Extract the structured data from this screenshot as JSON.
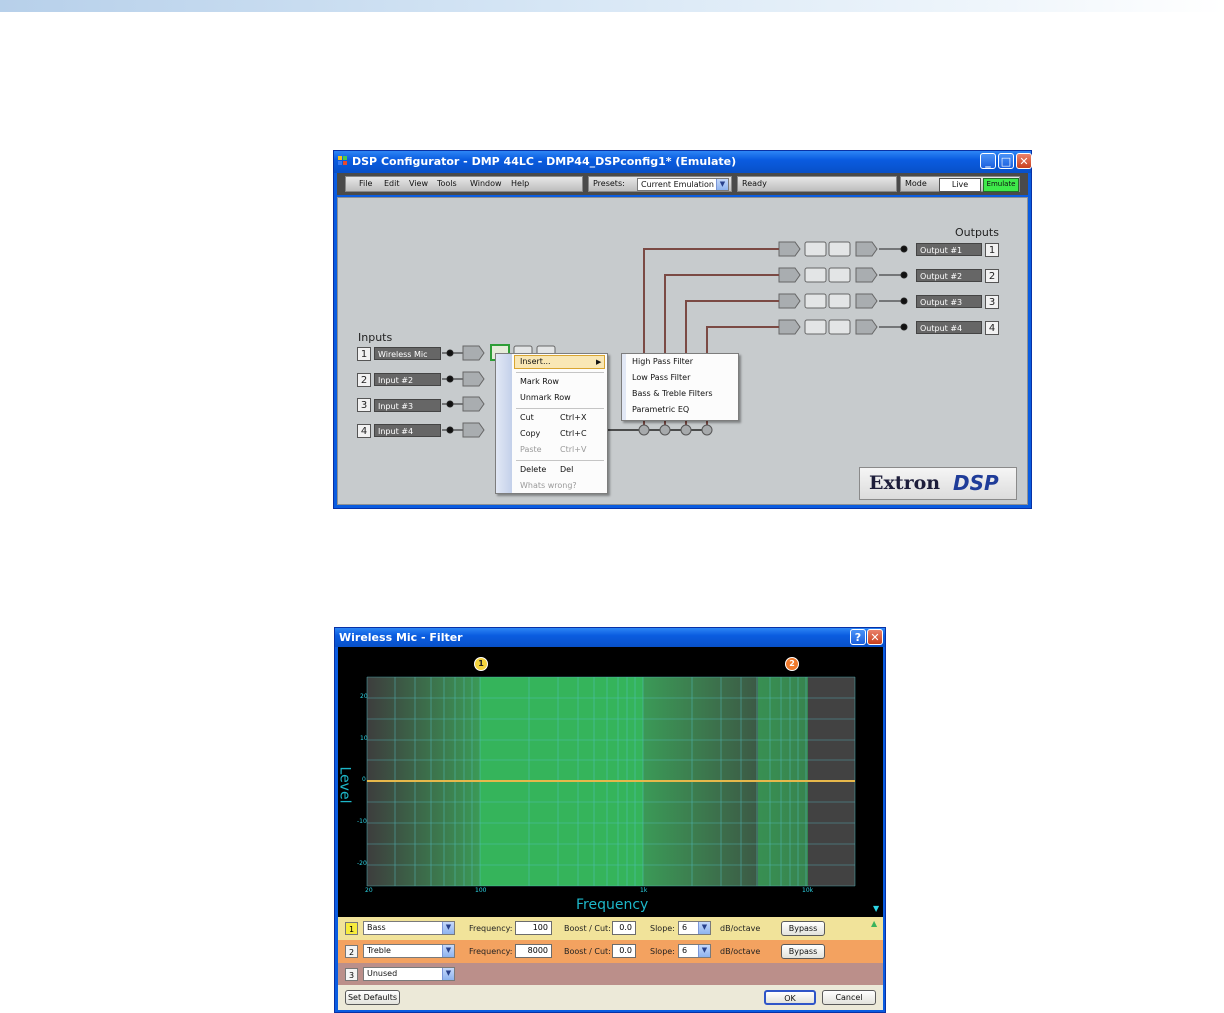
{
  "main_window": {
    "title": "DSP Configurator - DMP 44LC - DMP44_DSPconfig1* (Emulate)",
    "menu": [
      "File",
      "Edit",
      "View",
      "Tools",
      "Window",
      "Help"
    ],
    "presets_label": "Presets:",
    "presets_value": "Current Emulation",
    "status": "Ready",
    "mode_label": "Mode",
    "mode_live": "Live",
    "mode_emulate": "Emulate",
    "inputs_heading": "Inputs",
    "outputs_heading": "Outputs",
    "inputs": [
      {
        "num": "1",
        "name": "Wireless Mic"
      },
      {
        "num": "2",
        "name": "Input #2"
      },
      {
        "num": "3",
        "name": "Input #3"
      },
      {
        "num": "4",
        "name": "Input #4"
      }
    ],
    "outputs": [
      {
        "num": "1",
        "name": "Output #1"
      },
      {
        "num": "2",
        "name": "Output #2"
      },
      {
        "num": "3",
        "name": "Output #3"
      },
      {
        "num": "4",
        "name": "Output #4"
      }
    ],
    "context_menu": {
      "insert": "Insert...",
      "mark_row": "Mark Row",
      "unmark_row": "Unmark Row",
      "cut": "Cut",
      "cut_sc": "Ctrl+X",
      "copy": "Copy",
      "copy_sc": "Ctrl+C",
      "paste": "Paste",
      "paste_sc": "Ctrl+V",
      "delete": "Delete",
      "delete_sc": "Del",
      "whats_wrong": "Whats wrong?"
    },
    "submenu": [
      "High Pass Filter",
      "Low Pass Filter",
      "Bass & Treble Filters",
      "Parametric EQ"
    ],
    "logo_a": "Extron",
    "logo_b": "DSP"
  },
  "filter_window": {
    "title": "Wireless Mic - Filter",
    "help_btn": "?",
    "level_label": "Level",
    "frequency_label": "Frequency",
    "y_ticks": [
      "20",
      "10",
      "0",
      "-10",
      "-20"
    ],
    "x_ticks": [
      "20",
      "100",
      "1k",
      "10k"
    ],
    "markers": [
      "1",
      "2"
    ],
    "rows": [
      {
        "num": "1",
        "type": "Bass",
        "freq_label": "Frequency:",
        "freq": "100",
        "boost_label": "Boost / Cut:",
        "boost": "0.0",
        "slope_label": "Slope:",
        "slope": "6",
        "unit": "dB/octave",
        "bypass": "Bypass"
      },
      {
        "num": "2",
        "type": "Treble",
        "freq_label": "Frequency:",
        "freq": "8000",
        "boost_label": "Boost / Cut:",
        "boost": "0.0",
        "slope_label": "Slope:",
        "slope": "6",
        "unit": "dB/octave",
        "bypass": "Bypass"
      },
      {
        "num": "3",
        "type": "Unused"
      }
    ],
    "set_defaults": "Set Defaults",
    "ok": "OK",
    "cancel": "Cancel"
  },
  "colors": {
    "titlebar": "#0a5ce0",
    "graph_green": "#3bb35c",
    "flat_line": "#e6b84b",
    "row1_bg": "#f1e39a",
    "row2_bg": "#f3a260",
    "row3_bg": "#bb8f8a"
  }
}
